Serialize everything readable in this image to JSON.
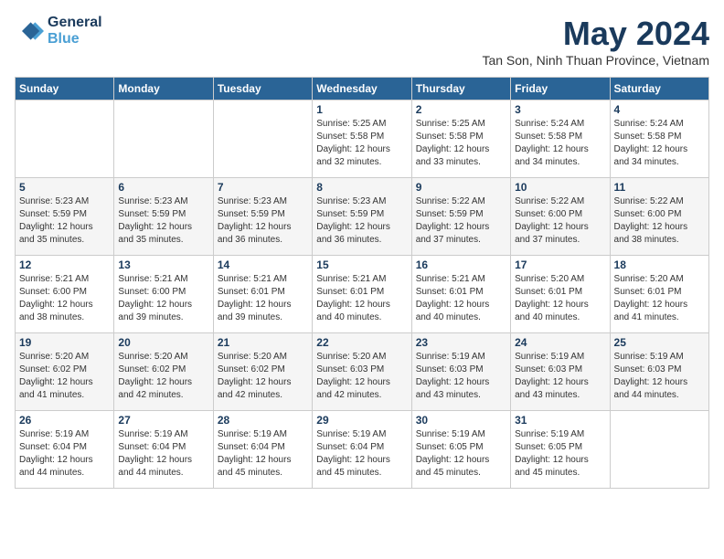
{
  "logo": {
    "line1": "General",
    "line2": "Blue"
  },
  "title": "May 2024",
  "location": "Tan Son, Ninh Thuan Province, Vietnam",
  "days_of_week": [
    "Sunday",
    "Monday",
    "Tuesday",
    "Wednesday",
    "Thursday",
    "Friday",
    "Saturday"
  ],
  "weeks": [
    [
      {
        "day": "",
        "info": ""
      },
      {
        "day": "",
        "info": ""
      },
      {
        "day": "",
        "info": ""
      },
      {
        "day": "1",
        "sunrise": "5:25 AM",
        "sunset": "5:58 PM",
        "daylight": "12 hours and 32 minutes."
      },
      {
        "day": "2",
        "sunrise": "5:25 AM",
        "sunset": "5:58 PM",
        "daylight": "12 hours and 33 minutes."
      },
      {
        "day": "3",
        "sunrise": "5:24 AM",
        "sunset": "5:58 PM",
        "daylight": "12 hours and 34 minutes."
      },
      {
        "day": "4",
        "sunrise": "5:24 AM",
        "sunset": "5:58 PM",
        "daylight": "12 hours and 34 minutes."
      }
    ],
    [
      {
        "day": "5",
        "sunrise": "5:23 AM",
        "sunset": "5:59 PM",
        "daylight": "12 hours and 35 minutes."
      },
      {
        "day": "6",
        "sunrise": "5:23 AM",
        "sunset": "5:59 PM",
        "daylight": "12 hours and 35 minutes."
      },
      {
        "day": "7",
        "sunrise": "5:23 AM",
        "sunset": "5:59 PM",
        "daylight": "12 hours and 36 minutes."
      },
      {
        "day": "8",
        "sunrise": "5:23 AM",
        "sunset": "5:59 PM",
        "daylight": "12 hours and 36 minutes."
      },
      {
        "day": "9",
        "sunrise": "5:22 AM",
        "sunset": "5:59 PM",
        "daylight": "12 hours and 37 minutes."
      },
      {
        "day": "10",
        "sunrise": "5:22 AM",
        "sunset": "6:00 PM",
        "daylight": "12 hours and 37 minutes."
      },
      {
        "day": "11",
        "sunrise": "5:22 AM",
        "sunset": "6:00 PM",
        "daylight": "12 hours and 38 minutes."
      }
    ],
    [
      {
        "day": "12",
        "sunrise": "5:21 AM",
        "sunset": "6:00 PM",
        "daylight": "12 hours and 38 minutes."
      },
      {
        "day": "13",
        "sunrise": "5:21 AM",
        "sunset": "6:00 PM",
        "daylight": "12 hours and 39 minutes."
      },
      {
        "day": "14",
        "sunrise": "5:21 AM",
        "sunset": "6:01 PM",
        "daylight": "12 hours and 39 minutes."
      },
      {
        "day": "15",
        "sunrise": "5:21 AM",
        "sunset": "6:01 PM",
        "daylight": "12 hours and 40 minutes."
      },
      {
        "day": "16",
        "sunrise": "5:21 AM",
        "sunset": "6:01 PM",
        "daylight": "12 hours and 40 minutes."
      },
      {
        "day": "17",
        "sunrise": "5:20 AM",
        "sunset": "6:01 PM",
        "daylight": "12 hours and 40 minutes."
      },
      {
        "day": "18",
        "sunrise": "5:20 AM",
        "sunset": "6:01 PM",
        "daylight": "12 hours and 41 minutes."
      }
    ],
    [
      {
        "day": "19",
        "sunrise": "5:20 AM",
        "sunset": "6:02 PM",
        "daylight": "12 hours and 41 minutes."
      },
      {
        "day": "20",
        "sunrise": "5:20 AM",
        "sunset": "6:02 PM",
        "daylight": "12 hours and 42 minutes."
      },
      {
        "day": "21",
        "sunrise": "5:20 AM",
        "sunset": "6:02 PM",
        "daylight": "12 hours and 42 minutes."
      },
      {
        "day": "22",
        "sunrise": "5:20 AM",
        "sunset": "6:03 PM",
        "daylight": "12 hours and 42 minutes."
      },
      {
        "day": "23",
        "sunrise": "5:19 AM",
        "sunset": "6:03 PM",
        "daylight": "12 hours and 43 minutes."
      },
      {
        "day": "24",
        "sunrise": "5:19 AM",
        "sunset": "6:03 PM",
        "daylight": "12 hours and 43 minutes."
      },
      {
        "day": "25",
        "sunrise": "5:19 AM",
        "sunset": "6:03 PM",
        "daylight": "12 hours and 44 minutes."
      }
    ],
    [
      {
        "day": "26",
        "sunrise": "5:19 AM",
        "sunset": "6:04 PM",
        "daylight": "12 hours and 44 minutes."
      },
      {
        "day": "27",
        "sunrise": "5:19 AM",
        "sunset": "6:04 PM",
        "daylight": "12 hours and 44 minutes."
      },
      {
        "day": "28",
        "sunrise": "5:19 AM",
        "sunset": "6:04 PM",
        "daylight": "12 hours and 45 minutes."
      },
      {
        "day": "29",
        "sunrise": "5:19 AM",
        "sunset": "6:04 PM",
        "daylight": "12 hours and 45 minutes."
      },
      {
        "day": "30",
        "sunrise": "5:19 AM",
        "sunset": "6:05 PM",
        "daylight": "12 hours and 45 minutes."
      },
      {
        "day": "31",
        "sunrise": "5:19 AM",
        "sunset": "6:05 PM",
        "daylight": "12 hours and 45 minutes."
      },
      {
        "day": "",
        "info": ""
      }
    ]
  ]
}
